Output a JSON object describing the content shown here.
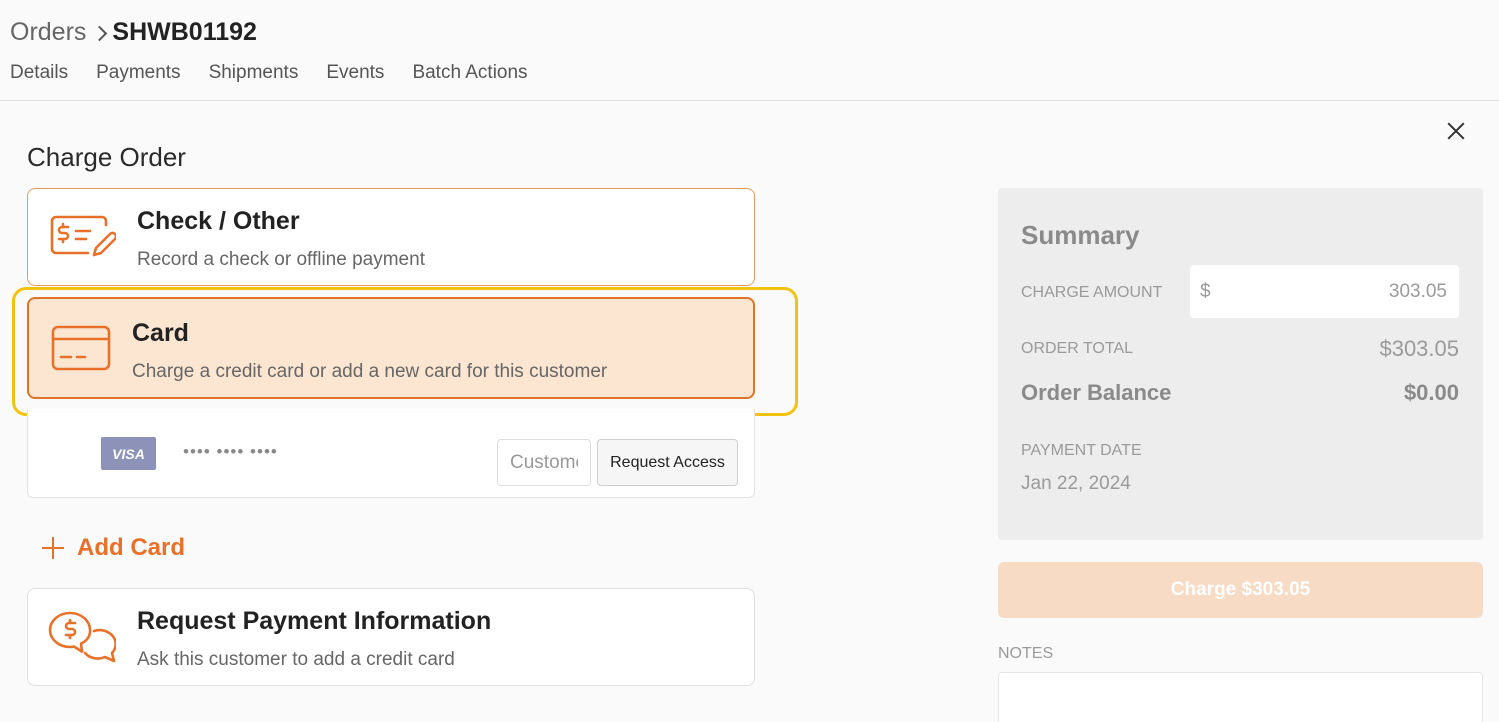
{
  "breadcrumb": {
    "root": "Orders",
    "current": "SHWB01192"
  },
  "tabs": [
    "Details",
    "Payments",
    "Shipments",
    "Events",
    "Batch Actions"
  ],
  "page_title": "Charge Order",
  "options": {
    "check": {
      "title": "Check / Other",
      "description": "Record a check or offline payment"
    },
    "card": {
      "title": "Card",
      "description": "Charge a credit card or add a new card for this customer"
    },
    "request": {
      "title": "Request Payment Information",
      "description": "Ask this customer to add a credit card"
    }
  },
  "saved_card": {
    "brand": "VISA",
    "masked_number": "•••• •••• ••••",
    "input_placeholder": "Customer",
    "request_access_label": "Request Access"
  },
  "add_card_label": "Add Card",
  "summary": {
    "title": "Summary",
    "charge_amount_label": "CHARGE AMOUNT",
    "currency_symbol": "$",
    "charge_amount_value": "303.05",
    "order_total_label": "ORDER TOTAL",
    "order_total_value": "$303.05",
    "order_balance_label": "Order Balance",
    "order_balance_value": "$0.00",
    "payment_date_label": "PAYMENT DATE",
    "payment_date_value": "Jan 22, 2024"
  },
  "charge_button_label": "Charge $303.05",
  "notes_label": "NOTES",
  "colors": {
    "accent": "#e8712a",
    "highlight": "#f2c211",
    "card_selected_bg": "#fce6d1"
  }
}
